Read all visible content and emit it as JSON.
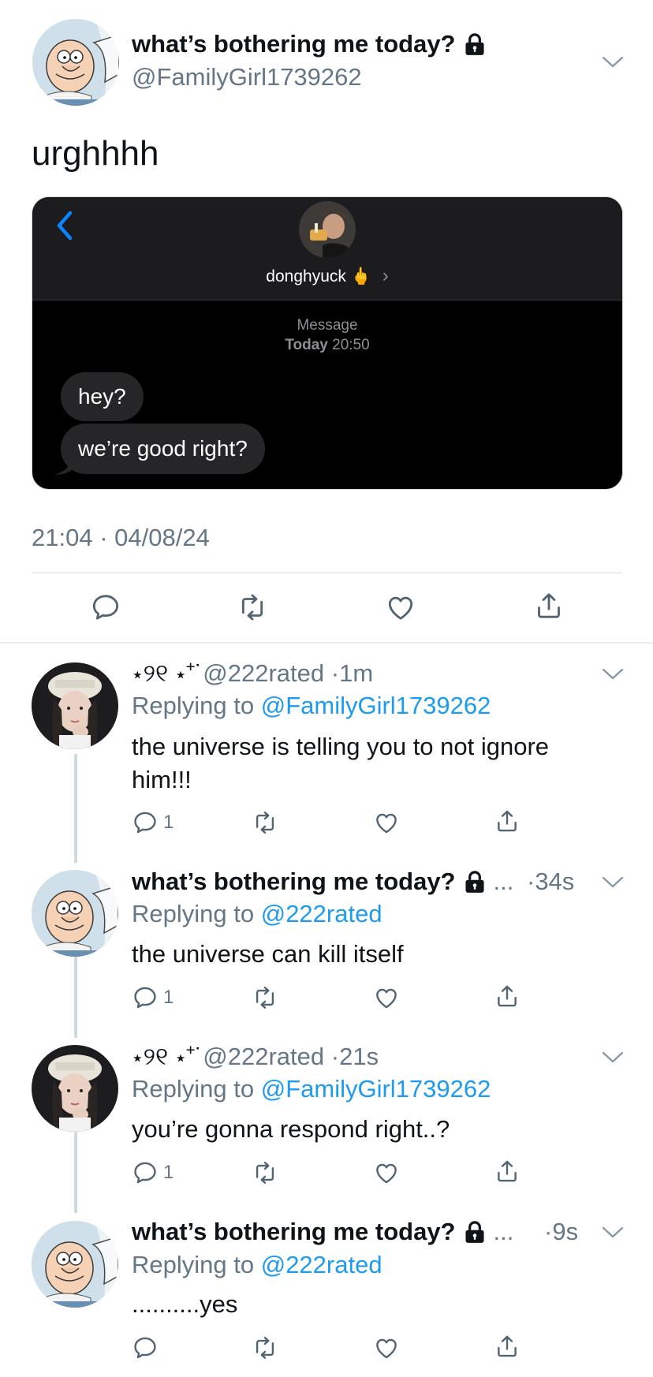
{
  "main_tweet": {
    "name": "what’s bothering me today?",
    "handle": "@FamilyGirl1739262",
    "text": "urghhhh",
    "timestamp": "21:04 · 04/08/24"
  },
  "screenshot": {
    "contact_name": "donghyuck 🖕",
    "chevron": "›",
    "meta_service": "Message",
    "meta_day": "Today",
    "meta_time": "20:50",
    "messages": [
      "hey?",
      "we’re good right?"
    ]
  },
  "replies": [
    {
      "name": "⋆୨୧ ⋆⁺˙",
      "handle": "@222rated",
      "dot": "·",
      "time": "1m",
      "replying_label": "Replying to",
      "replying_to": "@FamilyGirl1739262",
      "text": "the universe is telling you to not ignore him!!!",
      "reply_count": "1"
    },
    {
      "name": "what’s bothering me today?",
      "ellipsis": "...",
      "dot": "·",
      "time": "34s",
      "replying_label": "Replying to",
      "replying_to": "@222rated",
      "text": "the universe can kill itself",
      "reply_count": "1"
    },
    {
      "name": "⋆୨୧ ⋆⁺˙",
      "handle": "@222rated",
      "dot": "·",
      "time": "21s",
      "replying_label": "Replying to",
      "replying_to": "@FamilyGirl1739262",
      "text": "you’re gonna respond right..?",
      "reply_count": "1"
    },
    {
      "name": "what’s bothering me today?",
      "ellipsis": "...",
      "dot": "·",
      "time": "9s",
      "replying_label": "Replying to",
      "replying_to": "@222rated",
      "text": "..........yes",
      "reply_count": ""
    }
  ],
  "icons": {
    "reply": "reply-icon",
    "retweet": "retweet-icon",
    "like": "heart-icon",
    "share": "share-icon",
    "lock": "lock-icon",
    "more": "chevron-down-icon"
  },
  "colors": {
    "link": "#1d9bf0",
    "secondary": "#657786",
    "imessage_bubble": "#262628",
    "imessage_back": "#0a84ff"
  }
}
